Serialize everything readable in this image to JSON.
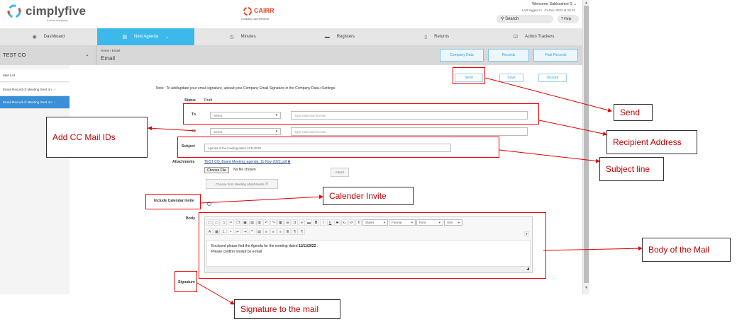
{
  "header": {
    "logo_main": "cimplyfive",
    "logo_sub": "a clear company",
    "cairr_name": "CAIRR",
    "cairr_sub": "Company Law Reference",
    "welcome": "Welcome Subhashini  S",
    "last_logged": "Last logged in : 01-Dec-2022 at 15:15",
    "search_label": "Search",
    "help_label": "Help"
  },
  "nav": [
    {
      "label": "Dashboard",
      "icon": "dashboard-icon",
      "active": false
    },
    {
      "label": "New Agenda",
      "icon": "agenda-icon",
      "active": true
    },
    {
      "label": "Minutes",
      "icon": "clock-icon",
      "active": false
    },
    {
      "label": "Registers",
      "icon": "folder-icon",
      "active": false
    },
    {
      "label": "Returns",
      "icon": "document-icon",
      "active": false
    },
    {
      "label": "Action Trackers",
      "icon": "checklist-icon",
      "active": false
    }
  ],
  "subbar": {
    "company": "TEST CO",
    "breadcrumb": "Home  /  Email",
    "title": "Email",
    "buttons": [
      "Company Data",
      "Records",
      "Past Records"
    ]
  },
  "left_panel": [
    "Mail List",
    "Email Record of Meeting Sent on:",
    "Email Record of Meeting Sent on:"
  ],
  "actions": {
    "send": "Send",
    "save": "Save",
    "discard": "Discard"
  },
  "form": {
    "note": "Note : To add/update your email signature, upload your Company Email Signature in the Company Data->Settings.",
    "status_label": "Status",
    "status_value": "Draft",
    "to_label": "To",
    "to_select": "Select",
    "to_placeholder": "Type email and hit enter",
    "cc_label": "cc",
    "cc_select": "Select",
    "cc_placeholder": "Type email and hit enter",
    "subject_label": "Subject",
    "subject_value": "Agenda of the meeting dated 11/11/2022",
    "attachments_label": "Attachments",
    "attachment_file": "TEST CO_Board Meeting_agenda_11-Nov-2022.pdf",
    "choose_file": "Choose File",
    "no_file": "No file chosen",
    "attach_button": "Attach",
    "meeting_attach_button": "Choose from Meeting Attachments",
    "calendar_label": "Include Calendar Invite",
    "body_label": "Body",
    "signature_label": "Signature",
    "body_line1_prefix": "Enclosed please find the Agenda for the meeting dated ",
    "body_date": "11/11/2022",
    "body_line1_suffix": " .",
    "body_line2": "Please confirm receipt by e-mail."
  },
  "editor": {
    "styles": "Styles",
    "format": "Format",
    "font": "Font",
    "size": "Size"
  },
  "callouts": {
    "send": "Send",
    "recipient": "Recipient Address",
    "subject": "Subject line",
    "cc": "Add CC Mail IDs",
    "calendar": "Calender Invite",
    "body": "Body of the Mail",
    "signature": "Signature to the mail"
  },
  "colors": {
    "accent": "#3cb9ea",
    "brand": "#e8452b",
    "annotation": "#e00000"
  }
}
